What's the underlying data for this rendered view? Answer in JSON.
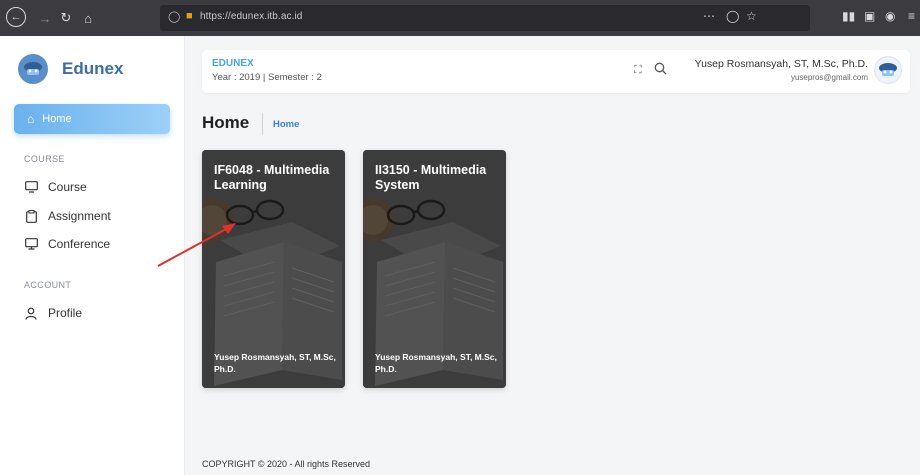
{
  "browser": {
    "url": "https://edunex.itb.ac.id"
  },
  "sidebar": {
    "brand": "Edunex",
    "home_label": "Home",
    "sections": [
      {
        "label": "COURSE",
        "items": [
          "Course",
          "Assignment",
          "Conference"
        ]
      },
      {
        "label": "ACCOUNT",
        "items": [
          "Profile"
        ]
      }
    ]
  },
  "header": {
    "app_name": "EDUNEX",
    "term": "Year : 2019 | Semester : 2",
    "user_name": "Yusep Rosmansyah, ST, M.Sc, Ph.D.",
    "user_email": "yusepros@gmail.com"
  },
  "page": {
    "title": "Home",
    "breadcrumb": "Home"
  },
  "courses": [
    {
      "title": "IF6048 - Multimedia Learning",
      "author": "Yusep Rosmansyah, ST, M.Sc, Ph.D."
    },
    {
      "title": "II3150 - Multimedia System",
      "author": "Yusep Rosmansyah, ST, M.Sc, Ph.D."
    }
  ],
  "footer": {
    "text": "COPYRIGHT © 2020 - All rights Reserved"
  },
  "colors": {
    "brand": "#3a6ea5",
    "accent": "#4aa3e8",
    "active_nav": "#6ab1ee",
    "annotation": "#e03030"
  }
}
